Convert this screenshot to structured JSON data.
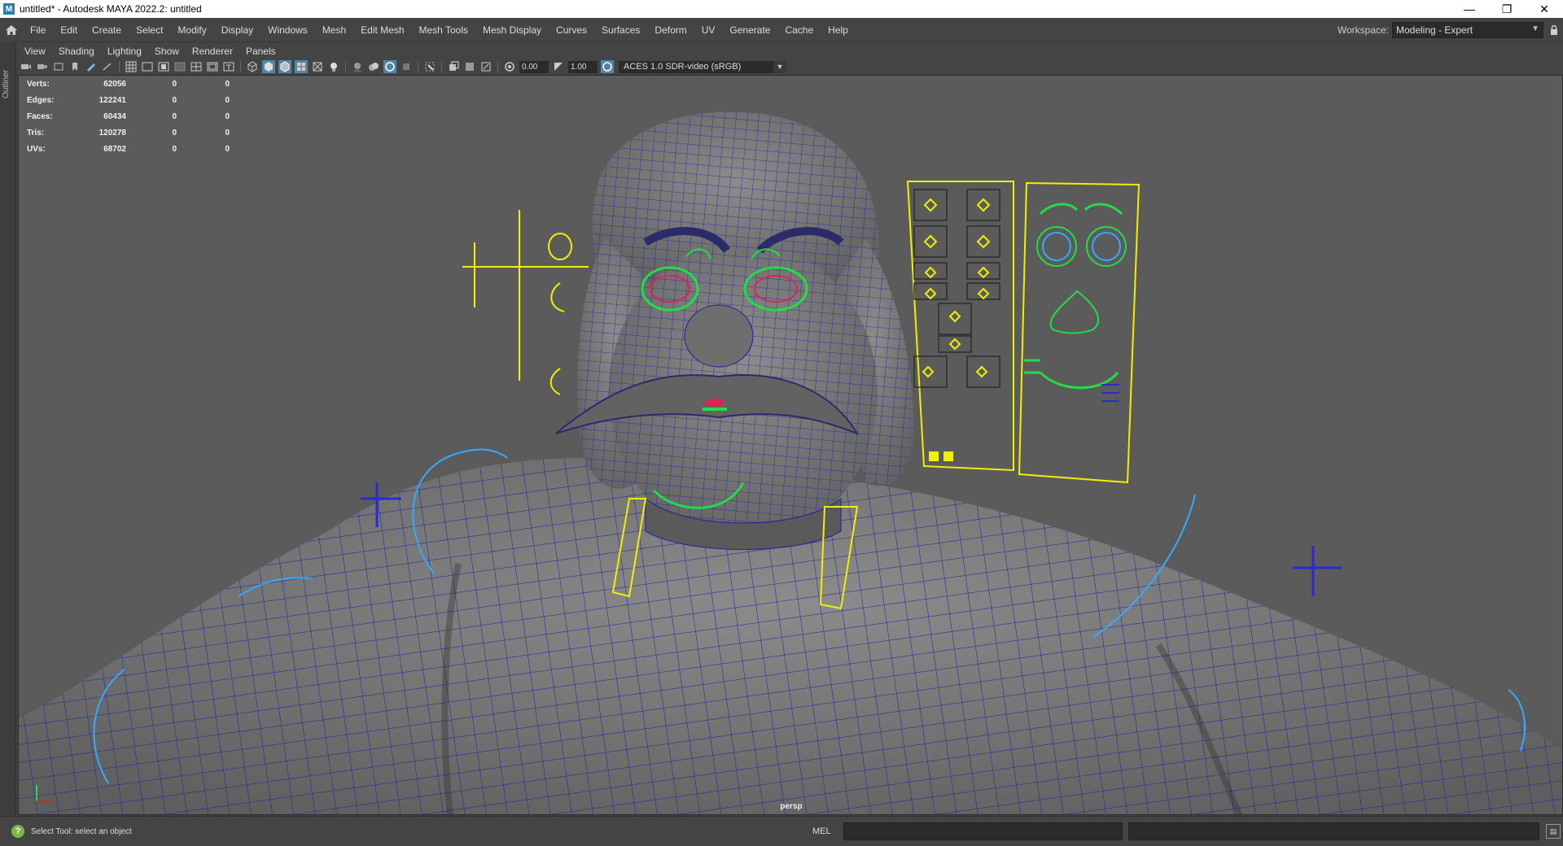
{
  "window": {
    "title": "untitled* - Autodesk MAYA 2022.2: untitled",
    "icon_letter": "M",
    "minimize": "—",
    "maximize": "❐",
    "close": "✕"
  },
  "menubar": {
    "items": [
      "File",
      "Edit",
      "Create",
      "Select",
      "Modify",
      "Display",
      "Windows",
      "Mesh",
      "Edit Mesh",
      "Mesh Tools",
      "Mesh Display",
      "Curves",
      "Surfaces",
      "Deform",
      "UV",
      "Generate",
      "Cache",
      "Help"
    ],
    "workspace_label": "Workspace:",
    "workspace_value": "Modeling - Expert"
  },
  "outliner": {
    "label": "Outliner"
  },
  "panel_menu": {
    "items": [
      "View",
      "Shading",
      "Lighting",
      "Show",
      "Renderer",
      "Panels"
    ]
  },
  "toolbar": {
    "exposure": "0.00",
    "gamma": "1.00",
    "color_management": "ACES 1.0 SDR-video (sRGB)"
  },
  "hud": {
    "rows": [
      {
        "label": "Verts:",
        "value": "62056",
        "a": "0",
        "b": "0"
      },
      {
        "label": "Edges:",
        "value": "122241",
        "a": "0",
        "b": "0"
      },
      {
        "label": "Faces:",
        "value": "60434",
        "a": "0",
        "b": "0"
      },
      {
        "label": "Tris:",
        "value": "120278",
        "a": "0",
        "b": "0"
      },
      {
        "label": "UVs:",
        "value": "68702",
        "a": "0",
        "b": "0"
      }
    ]
  },
  "viewport": {
    "camera": "persp",
    "colors": {
      "background": "#5b5b5b",
      "wire": "#1a1a9a",
      "control_yellow": "#f0f000",
      "control_green": "#22dd44",
      "control_cyan": "#33aaff"
    }
  },
  "statusbar": {
    "help_text": "Select Tool: select an object",
    "mel_label": "MEL"
  }
}
